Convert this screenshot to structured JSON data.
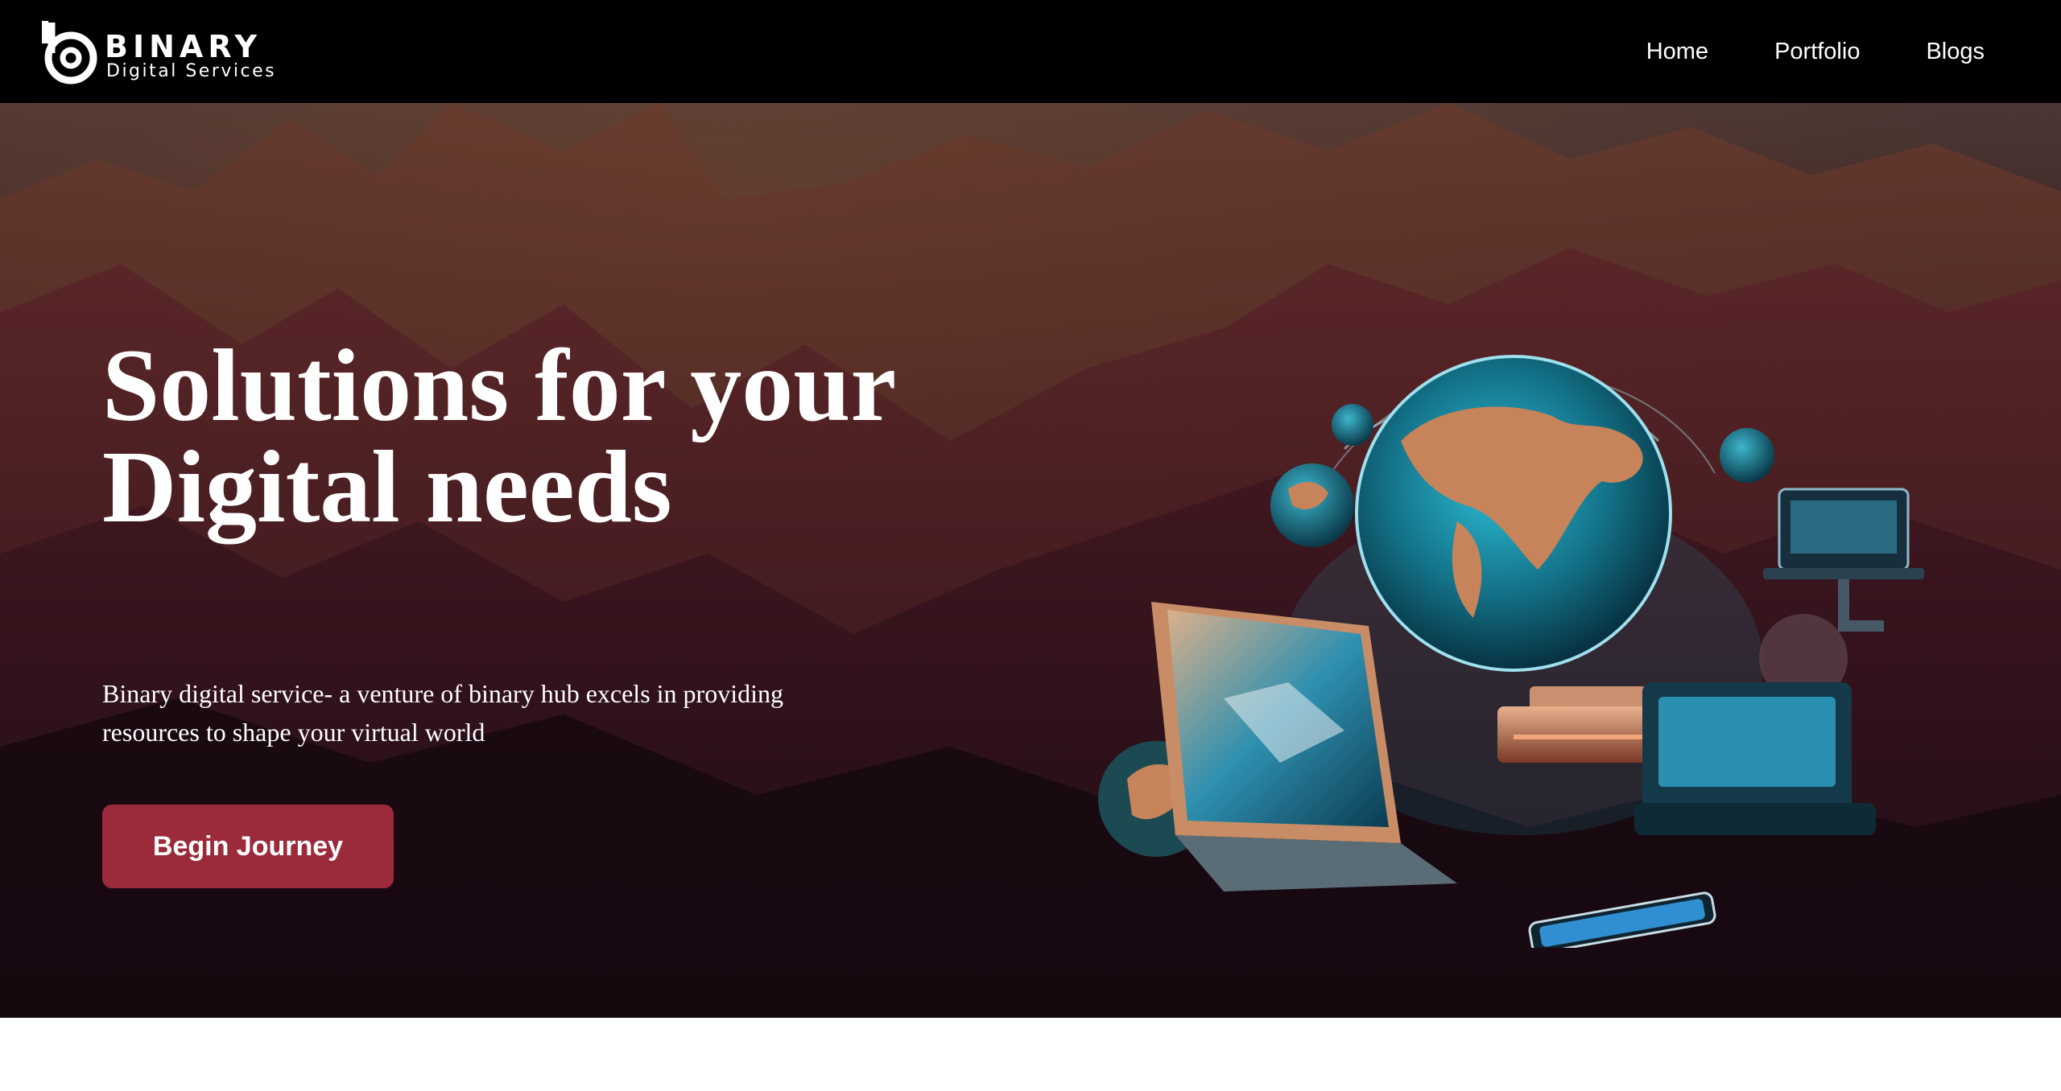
{
  "brand": {
    "name": "BINARY",
    "tagline": "Digital Services"
  },
  "nav": {
    "items": [
      {
        "label": "Home"
      },
      {
        "label": "Portfolio"
      },
      {
        "label": "Blogs"
      }
    ]
  },
  "hero": {
    "title_line1": "Solutions for your",
    "title_line2": "Digital needs",
    "description": "Binary digital service- a venture of binary hub excels in providing resources to shape your virtual world",
    "cta_label": "Begin Journey"
  },
  "colors": {
    "navbar_bg": "#000000",
    "cta_bg": "#9b2a3a",
    "hero_dark": "#150810",
    "globe_teal": "#1f8fa8",
    "continent_copper": "#c7835a"
  },
  "icons": {
    "logo": "binary-b-logo-icon",
    "illustration": "globe-devices-illustration"
  }
}
